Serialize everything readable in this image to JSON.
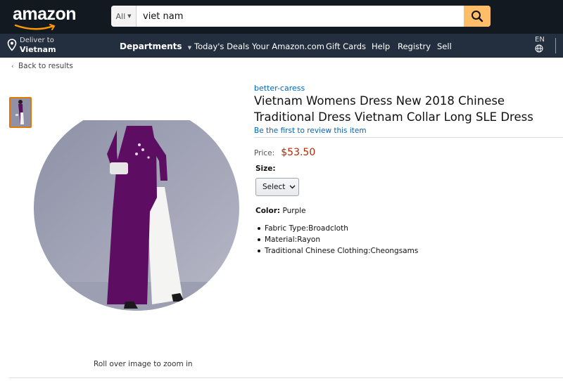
{
  "header": {
    "logo_text": "amazon",
    "search": {
      "dept_label": "All",
      "query": "viet nam"
    },
    "colors": {
      "topbar": "#131921",
      "navbar": "#232f3e",
      "search_button": "#febd69",
      "smile": "#ff9900"
    }
  },
  "nav": {
    "deliver_line1": "Deliver to",
    "deliver_line2": "Vietnam",
    "departments": "Departments",
    "links": [
      "Today's Deals",
      "Your Amazon.com",
      "Gift Cards",
      "Help",
      "Registry",
      "Sell"
    ],
    "language": "EN"
  },
  "breadcrumb": {
    "back": "Back to results"
  },
  "product": {
    "brand": "better-caress",
    "title": "Vietnam Womens Dress New 2018 Chinese Traditional Dress Vietnam Collar Long SLE Dress",
    "review_link": "Be the first to review this item",
    "price_label": "Price:",
    "price": "$53.50",
    "size_label": "Size:",
    "size_selected": "Select",
    "color_label": "Color:",
    "color_value": "Purple",
    "features": [
      "Fabric Type:Broadcloth",
      "Material:Rayon",
      "Traditional Chinese Clothing:Cheongsams"
    ],
    "zoom_hint": "Roll over image to zoom in"
  }
}
